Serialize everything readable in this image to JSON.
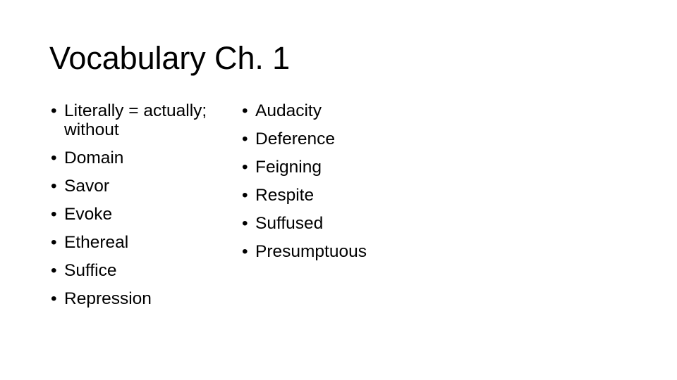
{
  "slide": {
    "title": "Vocabulary Ch. 1",
    "background_color": "#FFFFFF",
    "text_color": "#000000",
    "bullet_glyph": "•",
    "columns": [
      {
        "name": "left-column",
        "items": [
          "Literally = actually; without",
          "Domain",
          "Savor",
          "Evoke",
          "Ethereal",
          "Suffice",
          "Repression"
        ]
      },
      {
        "name": "right-column",
        "items": [
          "Audacity",
          "Deference",
          "Feigning",
          "Respite",
          "Suffused",
          "Presumptuous"
        ]
      }
    ]
  }
}
